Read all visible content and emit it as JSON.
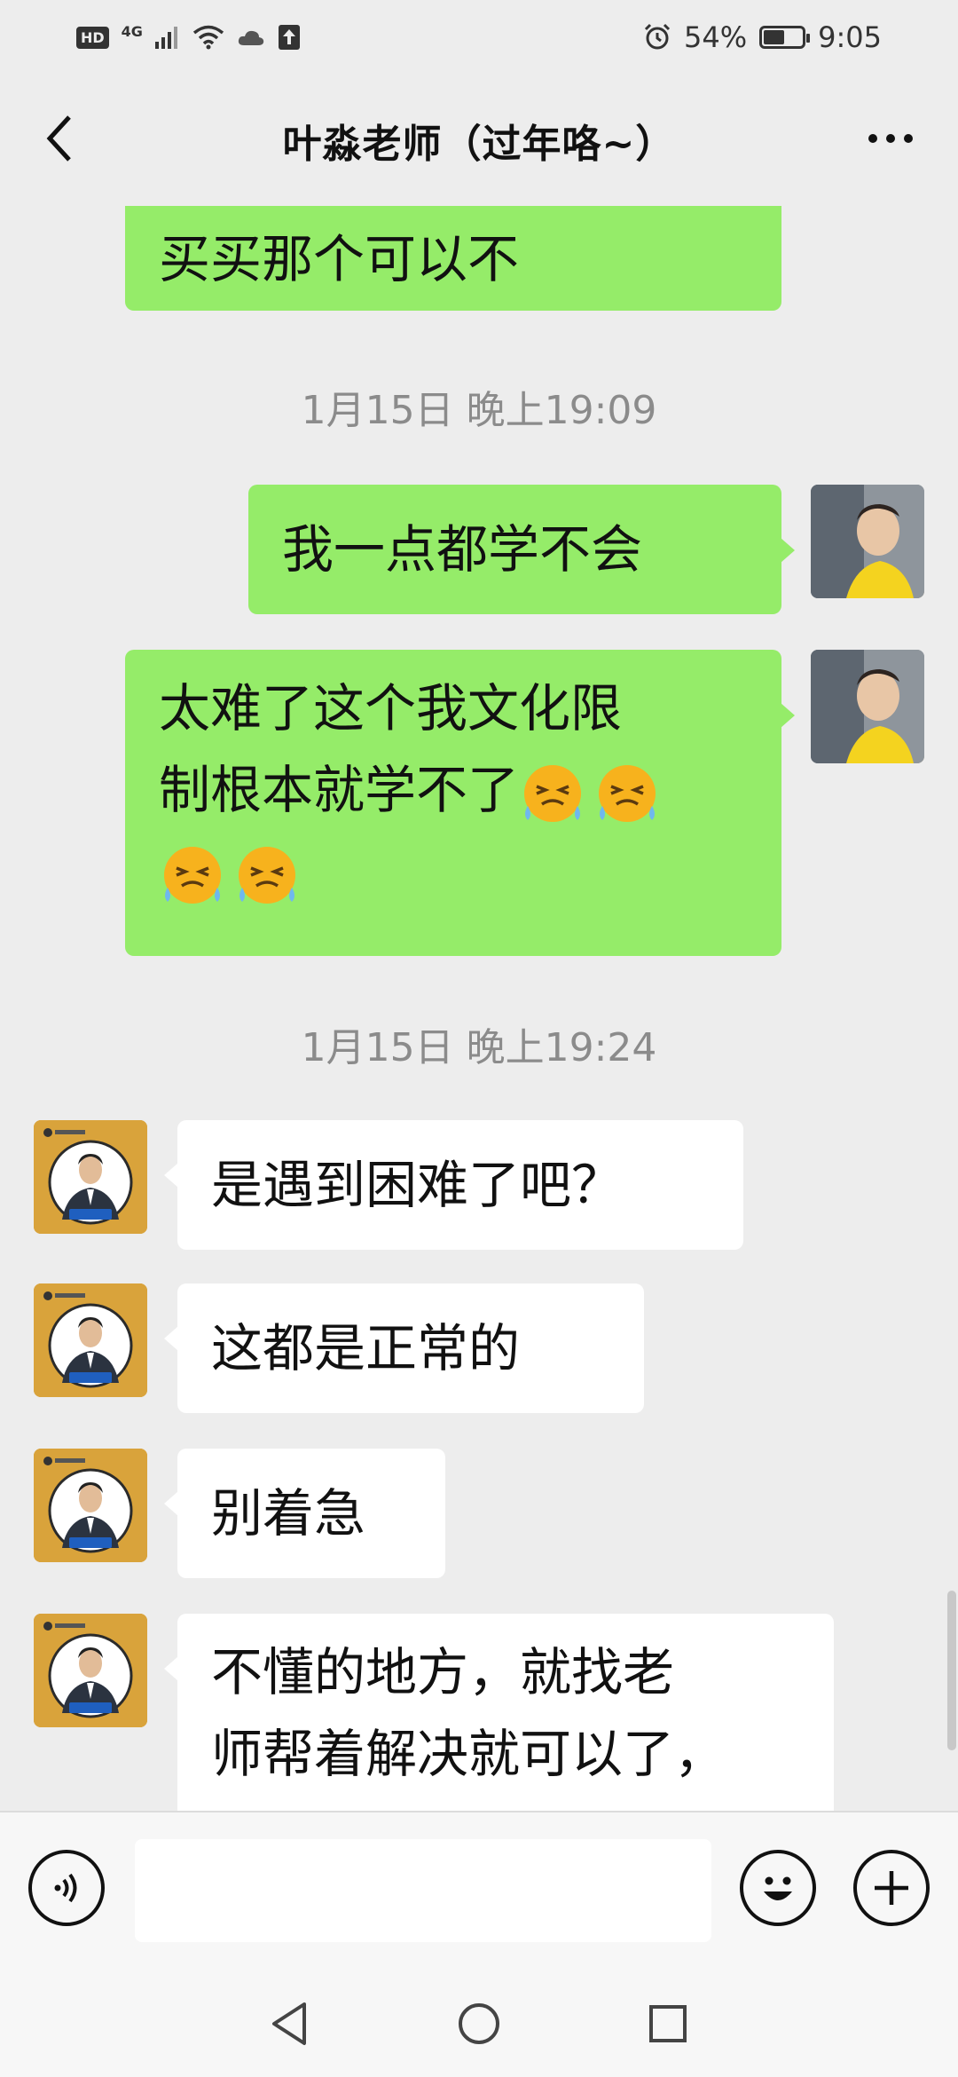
{
  "status_bar": {
    "hd": "HD",
    "network": "4G",
    "battery_text": "54%",
    "battery_level": 0.54,
    "time": "9:05"
  },
  "header": {
    "title": "叶淼老师（过年咯~）"
  },
  "messages": [
    {
      "sender": "me",
      "text": "买买那个可以不"
    },
    {
      "type": "time",
      "text": "1月15日 晚上19:09"
    },
    {
      "sender": "me",
      "text": "我一点都学不会"
    },
    {
      "sender": "me",
      "lines": [
        "太难了这个我文化限",
        "制根本就学不了"
      ],
      "emoji_count": 4
    },
    {
      "type": "time",
      "text": "1月15日 晚上19:24"
    },
    {
      "sender": "teacher",
      "text": "是遇到困难了吧？"
    },
    {
      "sender": "teacher",
      "text": "这都是正常的"
    },
    {
      "sender": "teacher",
      "text": "别着急"
    },
    {
      "sender": "teacher",
      "lines": [
        "不懂的地方，就找老",
        "师帮着解决就可以了，"
      ]
    }
  ],
  "input": {
    "placeholder": ""
  },
  "colors": {
    "my_bubble": "#95ec69",
    "their_bubble": "#ffffff",
    "background": "#ededed",
    "timestamp": "#8b8b8b",
    "teacher_avatar": "#d9a33b"
  },
  "icons": {
    "back": "chevron-left-icon",
    "more": "more-dots-icon",
    "voice": "voice-icon",
    "emoji": "smiley-icon",
    "plus": "plus-icon",
    "nav_back": "triangle-back-icon",
    "nav_home": "circle-home-icon",
    "nav_recent": "square-recent-icon"
  }
}
